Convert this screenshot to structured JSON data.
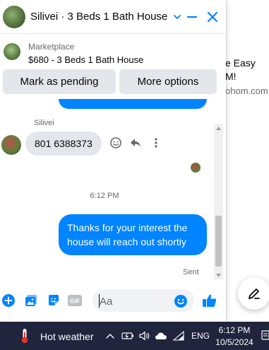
{
  "background": {
    "line1": "e Easy",
    "line2": "M!",
    "line3": "ohom.com"
  },
  "chat": {
    "title": "Silivei · 3 Beds 1 Bath House",
    "marketplace_label": "Marketplace",
    "listing_title": "$680 - 3 Beds 1 Bath House",
    "mark_pending_label": "Mark as pending",
    "more_options_label": "More options",
    "sender_name": "Silivei",
    "incoming_message": "801 6388373",
    "timestamp": "6:12 PM",
    "outgoing_message": "Thanks for your interest the house will reach  out shortiy",
    "sent_status": "Sent",
    "input_placeholder": "Aa",
    "gif_label": "GIF"
  },
  "colors": {
    "accent": "#0084ff",
    "taskbar": "#20243c",
    "bubble_incoming": "#e4e6eb"
  },
  "taskbar": {
    "weather_text": "Hot weather",
    "language": "ENG",
    "time": "6:12 PM",
    "date": "10/5/2024"
  }
}
